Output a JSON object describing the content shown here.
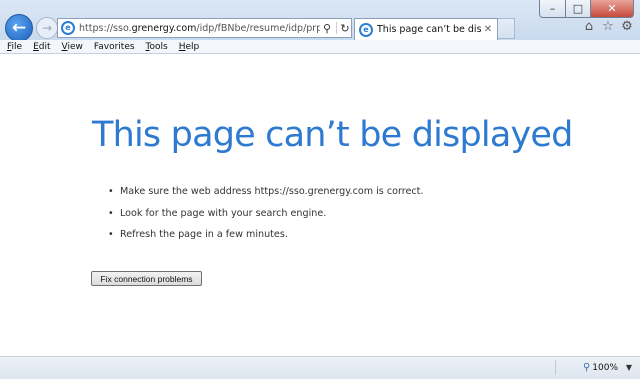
{
  "window": {
    "controls": {
      "minimize": "–",
      "maximize": "□",
      "close": "✕"
    }
  },
  "nav": {
    "back_glyph": "←",
    "forward_glyph": "→"
  },
  "address_bar": {
    "url_prefix": "https://sso.",
    "url_domain": "grenergy.com",
    "url_suffix": "/idp/fBNbe/resume/idp/prp.ping",
    "site_icon": "ie-page-icon",
    "search_glyph": "⚲",
    "refresh_glyph": "↻"
  },
  "tab": {
    "label": "This page can’t be displayed",
    "close_glyph": "✕"
  },
  "toolbar_icons": [
    {
      "name": "home-icon",
      "glyph": "⌂"
    },
    {
      "name": "favorites-star-icon",
      "glyph": "☆"
    },
    {
      "name": "tools-gear-icon",
      "glyph": "⚙"
    }
  ],
  "menu": {
    "items": [
      {
        "key": "F",
        "rest": "ile"
      },
      {
        "key": "E",
        "rest": "dit"
      },
      {
        "key": "V",
        "rest": "iew"
      },
      {
        "key": "",
        "rest": "Favorites",
        "keyIndex": "a"
      },
      {
        "key": "T",
        "rest": "ools"
      },
      {
        "key": "H",
        "rest": "elp"
      }
    ]
  },
  "page": {
    "heading": "This page can’t be displayed",
    "tips": [
      "Make sure the web address https://sso.grenergy.com is correct.",
      "Look for the page with your search engine.",
      "Refresh the page in a few minutes."
    ],
    "fix_button": "Fix connection problems"
  },
  "status_bar": {
    "zoom": "100%",
    "zoom_arrow": "▼"
  },
  "colors": {
    "heading": "#2e7ad1",
    "back_button": "#1b5fc0",
    "close_button": "#c7493b"
  }
}
